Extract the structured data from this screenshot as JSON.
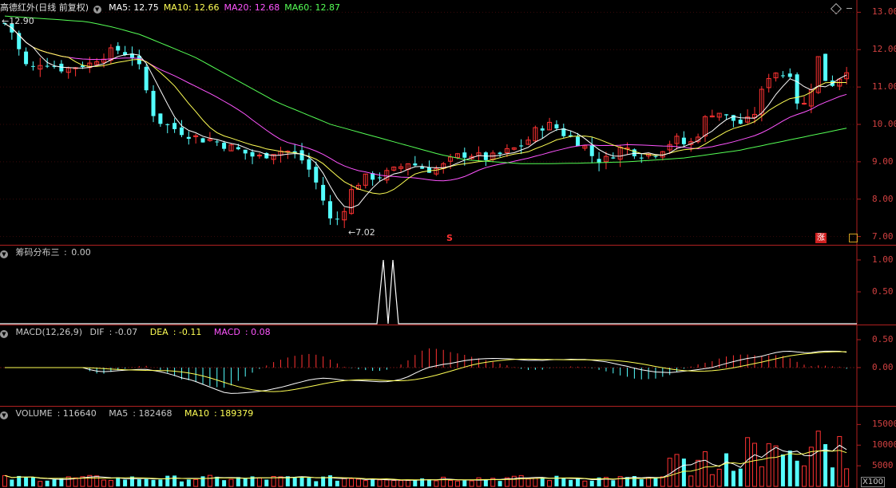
{
  "window": {
    "title": "高德红外(日线 前复权)"
  },
  "main": {
    "indicators": [
      {
        "name": "MA5",
        "value": "12.75",
        "color": "#ffffff"
      },
      {
        "name": "MA10",
        "value": "12.66",
        "color": "#ffff55"
      },
      {
        "name": "MA20",
        "value": "12.68",
        "color": "#ff55ff"
      },
      {
        "name": "MA60",
        "value": "12.87",
        "color": "#55ff55"
      }
    ],
    "y_ticks": [
      "13.00",
      "12.00",
      "11.00",
      "10.00",
      "9.00",
      "8.00",
      "7.00"
    ],
    "high_label": "12.90",
    "low_label": "7.02",
    "marker_s": "S",
    "marker_zhang": "涨",
    "up_color": "#ff3232",
    "down_color": "#54ffff"
  },
  "chip": {
    "label": "筹码分布三",
    "value": "0.00",
    "y_ticks": [
      "1.00",
      "0.50"
    ]
  },
  "macd": {
    "label": "MACD(12,26,9)",
    "dif": "-0.07",
    "dea": "-0.11",
    "macd": "0.08",
    "dif_label": "DIF",
    "dea_label": "DEA",
    "macd_label": "MACD",
    "y_ticks": [
      "0.50",
      "0.00"
    ]
  },
  "volume": {
    "label": "VOLUME",
    "value": "116640",
    "ma5_label": "MA5",
    "ma5": "182468",
    "ma10_label": "MA10",
    "ma10": "189379",
    "y_ticks": [
      "15000",
      "10000",
      "5000"
    ],
    "unit": "X100"
  },
  "chart_data": {
    "type": "candlestick",
    "candles_approx_count": 120,
    "close_path": [
      12.7,
      12.4,
      11.6,
      11.5,
      11.7,
      11.6,
      11.5,
      11.5,
      11.6,
      11.6,
      11.8,
      11.9,
      12.0,
      11.9,
      11.8,
      11.0,
      10.2,
      10.0,
      9.9,
      9.8,
      9.7,
      9.6,
      9.6,
      9.5,
      9.4,
      9.3,
      9.2,
      9.1,
      9.2,
      9.3,
      9.3,
      9.2,
      9.0,
      8.6,
      8.0,
      7.3,
      7.6,
      8.2,
      8.5,
      8.6,
      8.6,
      8.7,
      8.8,
      9.0,
      8.9,
      8.8,
      8.8,
      8.9,
      9.1,
      9.2,
      9.2,
      9.1,
      9.1,
      9.2,
      9.3,
      9.4,
      9.6,
      9.9,
      10.0,
      9.9,
      9.7,
      9.6,
      9.4,
      9.1,
      9.0,
      9.2,
      9.4,
      9.3,
      9.2,
      9.2,
      9.3,
      9.5,
      9.6,
      9.4,
      9.7,
      10.2,
      10.4,
      10.2,
      10.1,
      10.0,
      10.2,
      10.9,
      11.5,
      11.3,
      11.4,
      10.3,
      10.8,
      11.8,
      11.0,
      11.2,
      11.5
    ],
    "ma60_path": [
      12.9,
      12.85,
      12.8,
      12.75,
      12.6,
      12.4,
      12.1,
      11.8,
      11.4,
      11.0,
      10.6,
      10.3,
      10.0,
      9.8,
      9.6,
      9.4,
      9.2,
      9.05,
      9.0,
      8.95,
      8.95,
      8.96,
      8.98,
      9.0,
      9.05,
      9.1,
      9.2,
      9.3,
      9.45,
      9.6,
      9.75,
      9.9
    ],
    "chip_peaks": [
      1.0,
      1.0
    ],
    "y_range": [
      6.8,
      13.2
    ]
  }
}
